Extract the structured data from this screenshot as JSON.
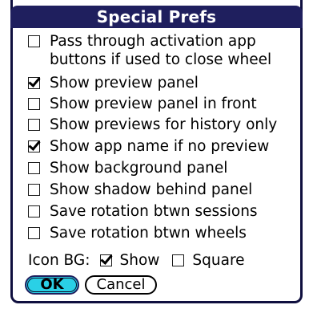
{
  "dialog": {
    "title": "Special Prefs"
  },
  "options": [
    {
      "line1": "Pass through activation app",
      "line2": "buttons if used to close wheel",
      "checked": false
    },
    {
      "line1": "Show preview panel",
      "checked": true
    },
    {
      "line1": "Show preview panel in front",
      "checked": false
    },
    {
      "line1": "Show previews for history only",
      "checked": false
    },
    {
      "line1": "Show app name if no preview",
      "checked": true
    },
    {
      "line1": "Show background panel",
      "checked": false
    },
    {
      "line1": "Show shadow behind panel",
      "checked": false
    },
    {
      "line1": "Save rotation btwn sessions",
      "checked": false
    },
    {
      "line1": "Save rotation btwn wheels",
      "checked": false
    }
  ],
  "icon_bg": {
    "label": "Icon BG:",
    "show_label": "Show",
    "show_checked": true,
    "square_label": "Square",
    "square_checked": false
  },
  "buttons": {
    "ok_label": "OK",
    "cancel_label": "Cancel"
  }
}
